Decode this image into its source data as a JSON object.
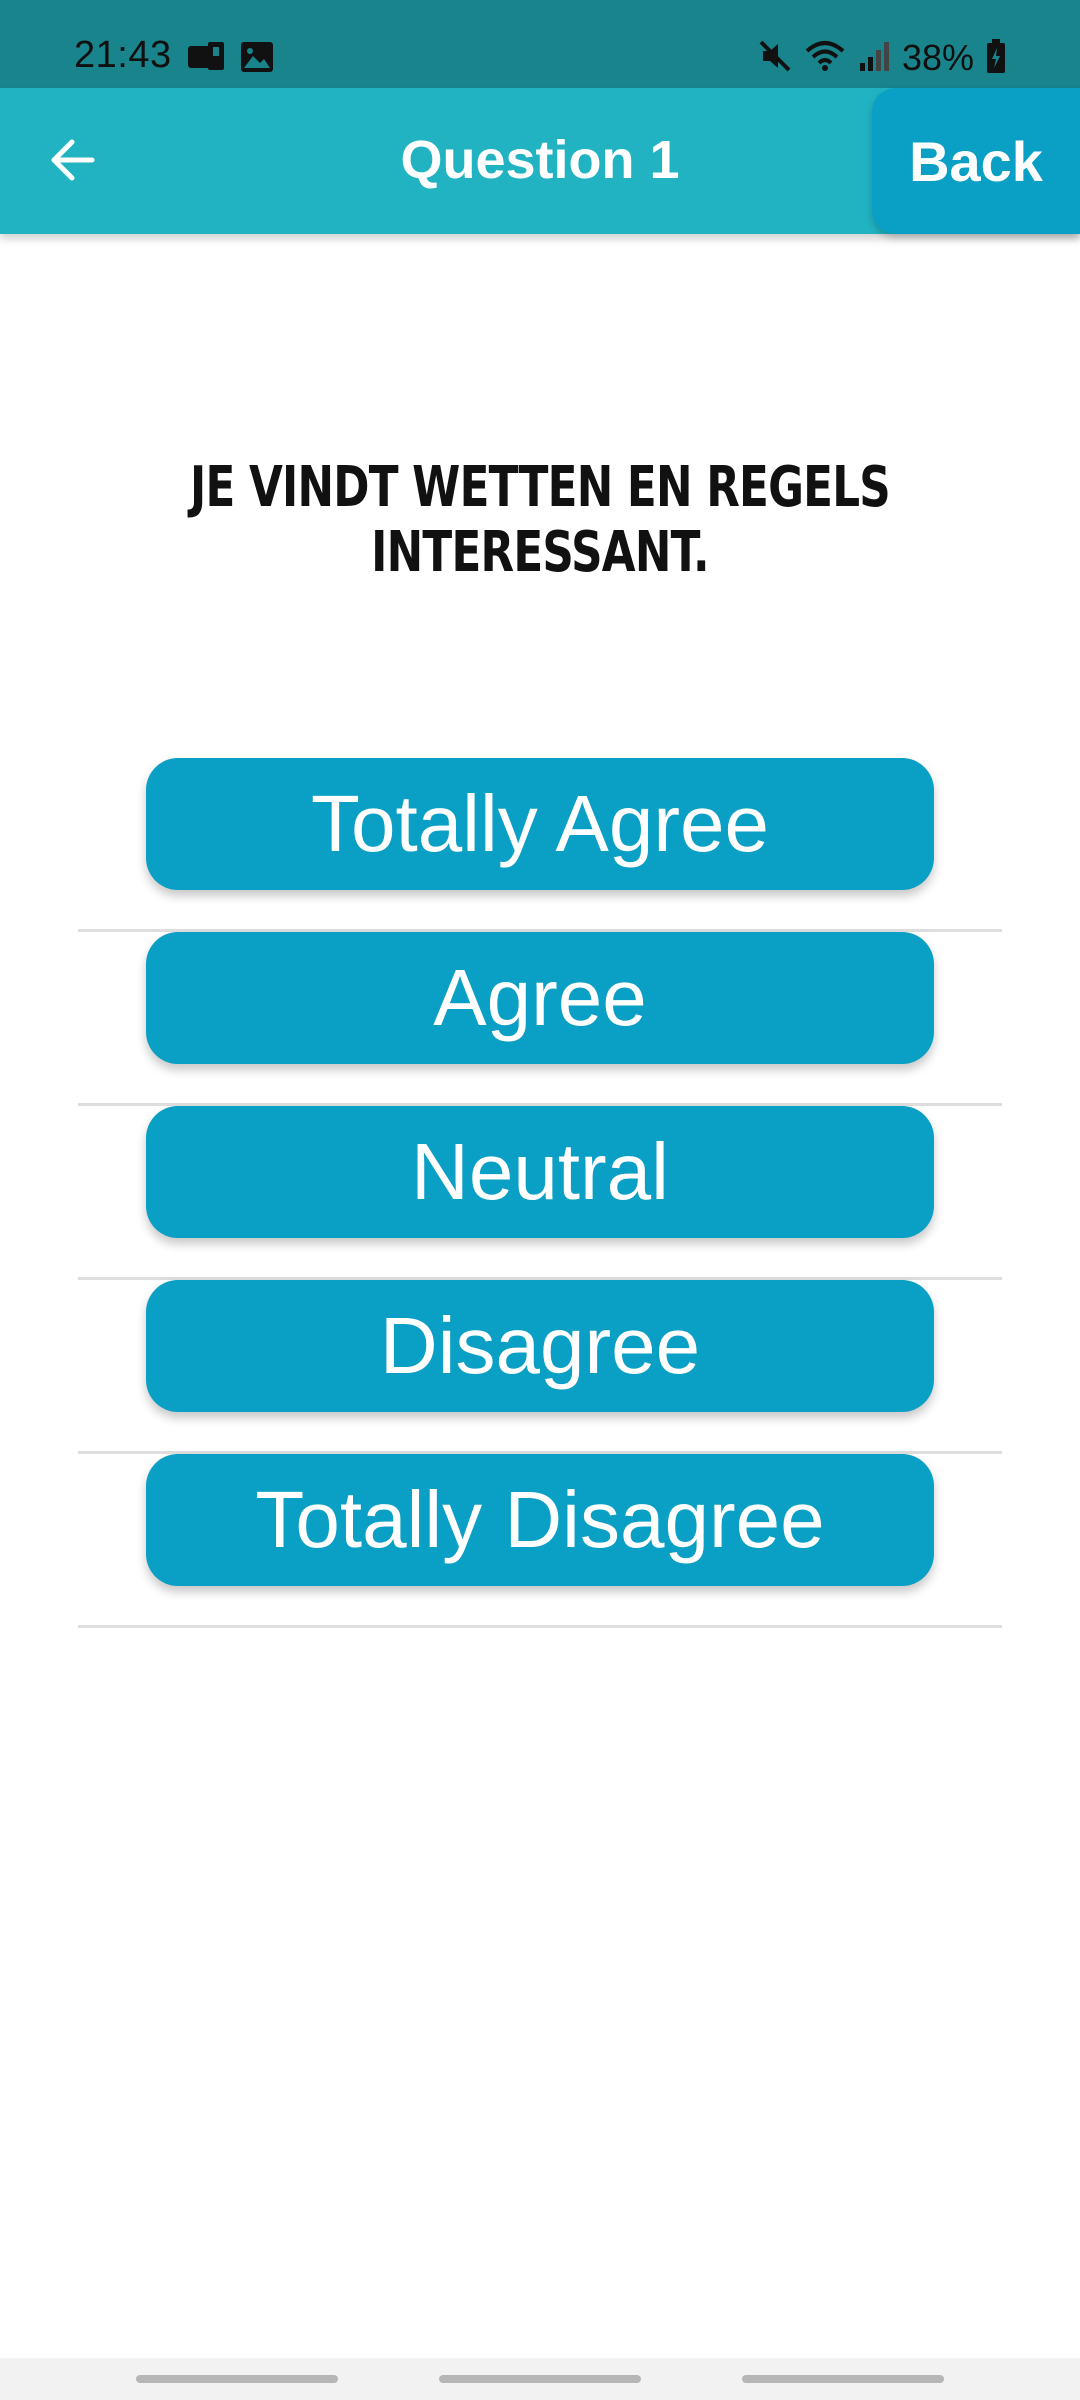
{
  "status_bar": {
    "time": "21:43",
    "battery": "38%",
    "icons": [
      "sim-icon",
      "gallery-icon",
      "mute-icon",
      "wifi-icon",
      "signal-icon",
      "battery-icon"
    ]
  },
  "app_bar": {
    "title": "Question 1",
    "back_button_label": "Back",
    "back_arrow_icon": "arrow-left-icon",
    "background_color": "#21b3c2"
  },
  "question": {
    "text": "JE VINDT WETTEN EN REGELS INTERESSANT."
  },
  "options": [
    {
      "label": "Totally Agree"
    },
    {
      "label": "Agree"
    },
    {
      "label": "Neutral"
    },
    {
      "label": "Disagree"
    },
    {
      "label": "Totally Disagree"
    }
  ],
  "colors": {
    "status_bar": "#1a848c",
    "accent_button": "#0aa0c5",
    "option_button": "#0a9fc4"
  }
}
